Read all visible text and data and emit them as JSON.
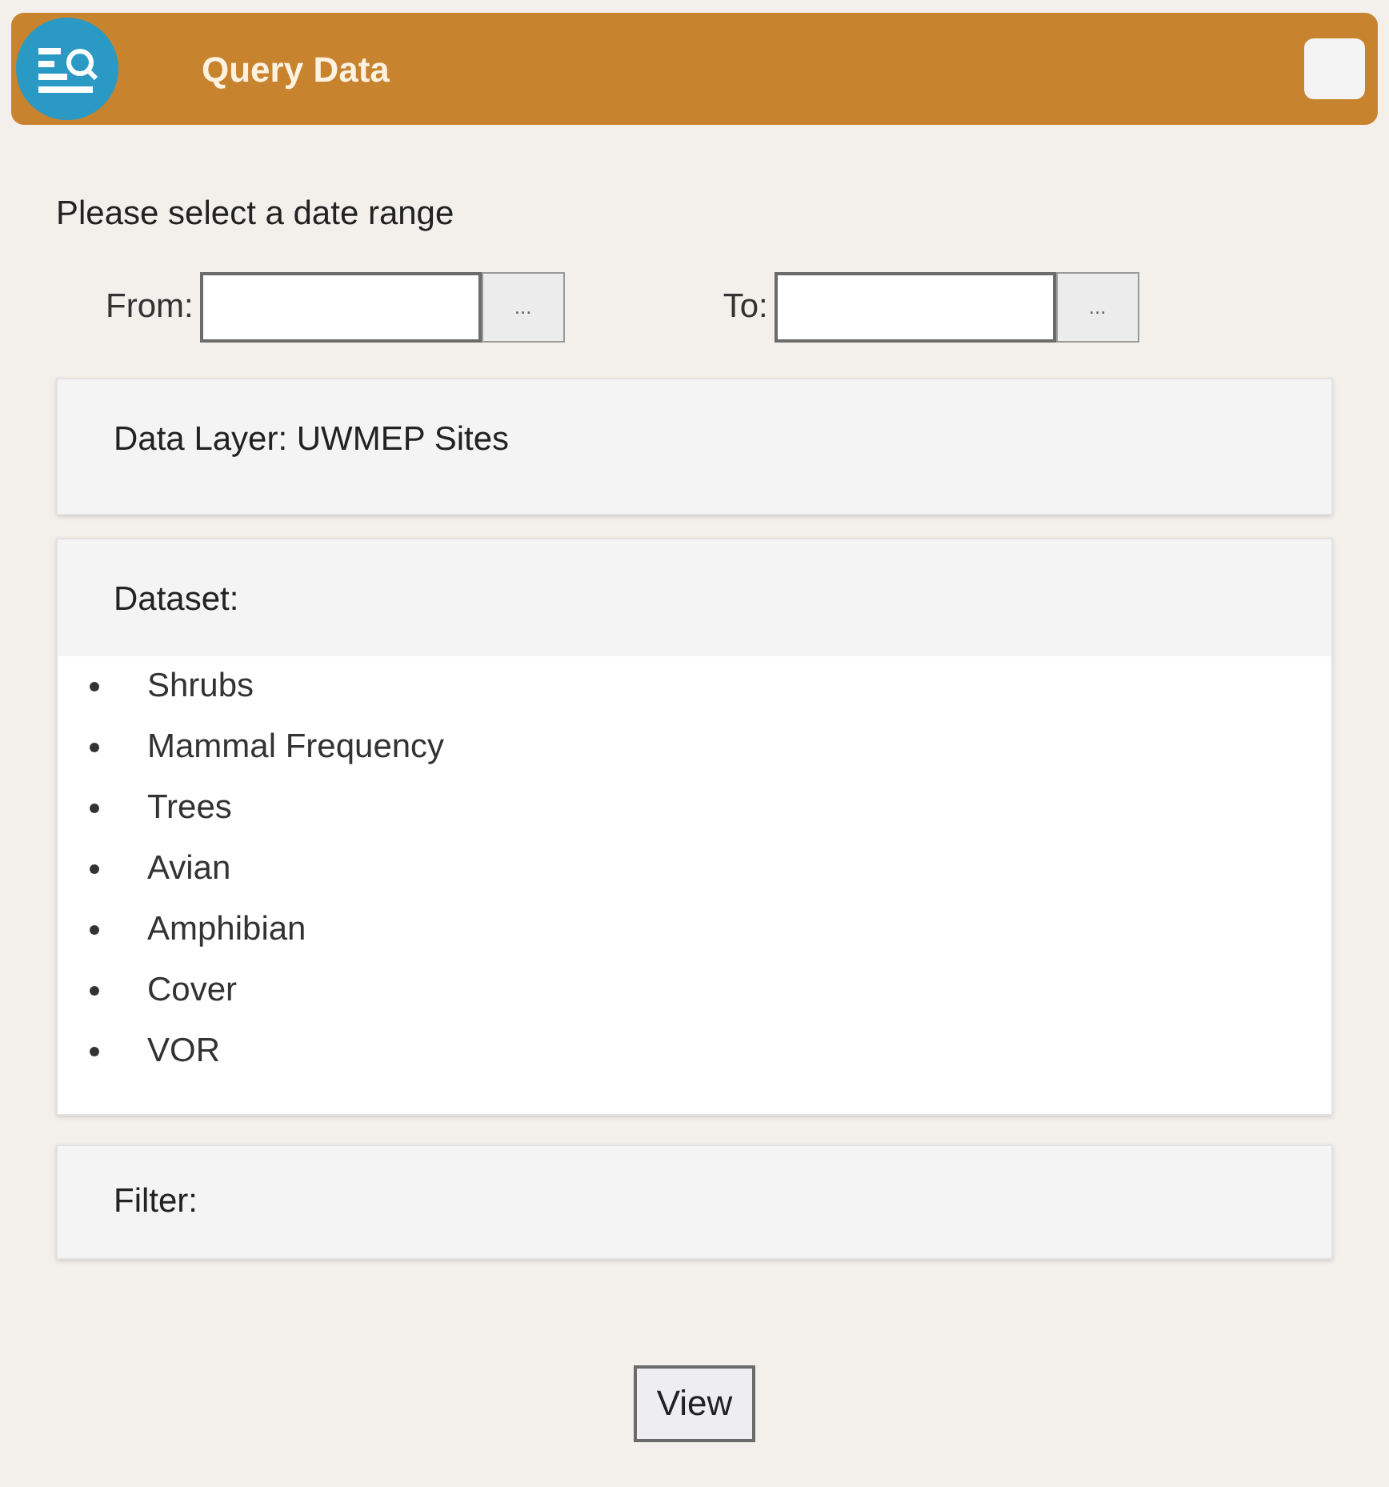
{
  "window": {
    "title": "Query Data"
  },
  "date_range": {
    "prompt": "Please select a date range",
    "from": {
      "label": "From:",
      "button": "..."
    },
    "to": {
      "label": "To:",
      "button": "..."
    }
  },
  "data_layer": {
    "label": "Data Layer: UWMEP Sites"
  },
  "dataset": {
    "label": "Dataset:",
    "items": [
      "Shrubs",
      "Mammal Frequency",
      "Trees",
      "Avian",
      "Amphibian",
      "Cover",
      "VOR"
    ]
  },
  "filter": {
    "label": "Filter:"
  },
  "buttons": [
    "View"
  ]
}
